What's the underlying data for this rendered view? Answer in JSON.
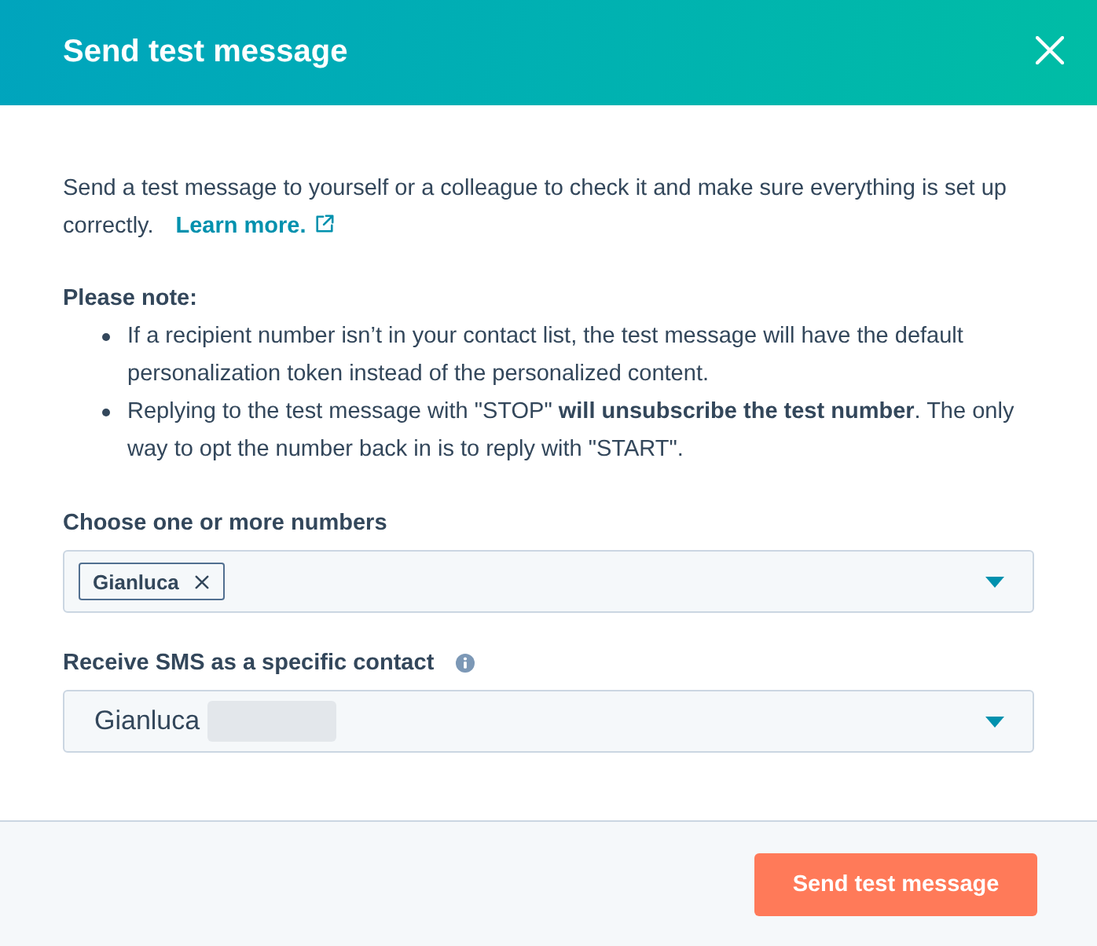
{
  "dialog": {
    "title": "Send test message"
  },
  "intro": {
    "text": "Send a test message to yourself or a colleague to check it and make sure everything is set up correctly.",
    "link": "Learn more."
  },
  "note": {
    "heading": "Please note:",
    "items": [
      "If a recipient number isn’t in your contact list, the test message will have the default personalization token instead of the personalized content.",
      "Replying to the test message with \"STOP\" **will unsubscribe the test number**. The only way to opt the number back in is to reply with \"START\"."
    ]
  },
  "fields": [
    {
      "kind": "tags",
      "label": "Choose one or more numbers",
      "tags": [
        "Gianluca"
      ]
    },
    {
      "kind": "select",
      "label": "Receive SMS as a specific contact",
      "info": true,
      "value": "Gianluca",
      "redacted": true
    }
  ],
  "footer": {
    "button": "Send test message"
  }
}
